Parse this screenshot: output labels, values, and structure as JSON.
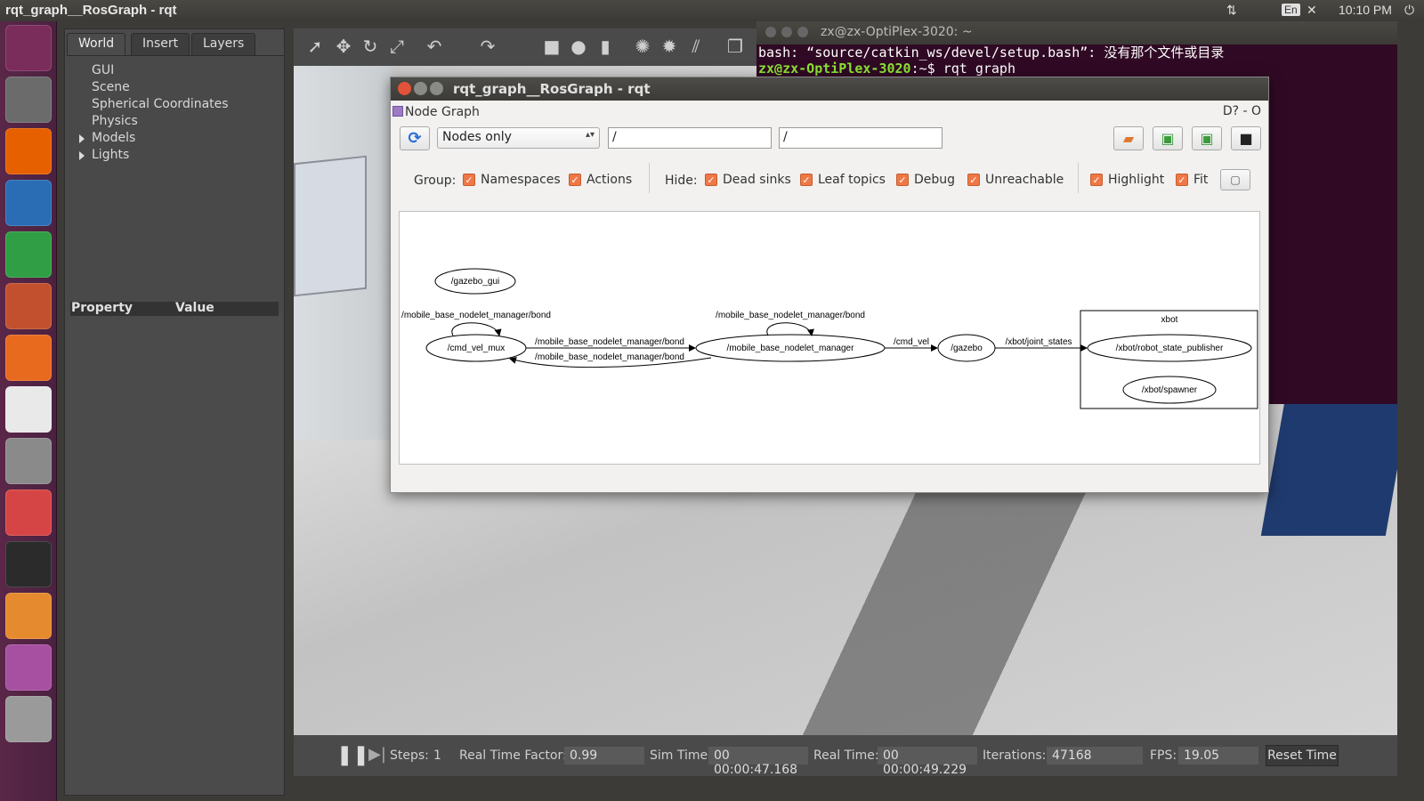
{
  "topbar": {
    "title": "rqt_graph__RosGraph - rqt",
    "lang": "En",
    "time": "10:10 PM"
  },
  "launcher": {
    "items": [
      {
        "name": "ubuntu-dash-icon",
        "color": "#7a2c5a"
      },
      {
        "name": "files-icon",
        "color": "#6b6b6b"
      },
      {
        "name": "firefox-icon",
        "color": "#e66000"
      },
      {
        "name": "writer-icon",
        "color": "#2a6db5"
      },
      {
        "name": "calc-icon",
        "color": "#2f9e44"
      },
      {
        "name": "impress-icon",
        "color": "#c2502e"
      },
      {
        "name": "software-center-icon",
        "color": "#e86a1f"
      },
      {
        "name": "amazon-icon",
        "color": "#e9e9e9"
      },
      {
        "name": "system-settings-icon",
        "color": "#8a8a8a"
      },
      {
        "name": "document-viewer-icon",
        "color": "#d64545"
      },
      {
        "name": "terminal-icon",
        "color": "#2b2b2b"
      },
      {
        "name": "gazebo-icon",
        "color": "#e58a2e"
      },
      {
        "name": "rqt-icon",
        "color": "#a74fa0"
      },
      {
        "name": "trash-icon",
        "color": "#9a9a9a"
      }
    ]
  },
  "gazebo": {
    "tabs": [
      "World",
      "Insert",
      "Layers"
    ],
    "tree": [
      "GUI",
      "Scene",
      "Spherical Coordinates",
      "Physics",
      "Models",
      "Lights"
    ],
    "property_header": {
      "property": "Property",
      "value": "Value"
    },
    "status": {
      "steps_label": "Steps:",
      "steps_value": "1",
      "rtf_label": "Real Time Factor:",
      "rtf_value": "0.99",
      "sim_label": "Sim Time:",
      "sim_value": "00 00:00:47.168",
      "real_label": "Real Time:",
      "real_value": "00 00:00:49.229",
      "iter_label": "Iterations:",
      "iter_value": "47168",
      "fps_label": "FPS:",
      "fps_value": "19.05",
      "reset_label": "Reset Time"
    }
  },
  "terminal": {
    "title": "zx@zx-OptiPlex-3020: ~",
    "line1": "bash: “source/catkin_ws/devel/setup.bash”: 没有那个文件或目录",
    "prompt": "zx@zx-OptiPlex-3020",
    "path": ":~$ rqt graph"
  },
  "rqt": {
    "title": "rqt_graph__RosGraph - rqt",
    "plugin": "Node Graph",
    "mode": "Nodes only",
    "filter1": "/",
    "filter2": "/",
    "group_label": "Group:",
    "hide_label": "Hide:",
    "checks": {
      "namespaces": "Namespaces",
      "actions": "Actions",
      "dead_sinks": "Dead sinks",
      "leaf_topics": "Leaf topics",
      "debug": "Debug",
      "unreachable": "Unreachable",
      "highlight": "Highlight",
      "fit": "Fit"
    },
    "corner": "D? - O"
  },
  "graph": {
    "nodes": {
      "gazebo_gui": "/gazebo_gui",
      "cmd_vel_mux": "/cmd_vel_mux",
      "manager": "/mobile_base_nodelet_manager",
      "gazebo": "/gazebo",
      "robot_state_publisher": "/xbot/robot_state_publisher",
      "spawner": "/xbot/spawner"
    },
    "cluster": "xbot",
    "edges": {
      "bond_loop_mux": "/mobile_base_nodelet_manager/bond",
      "bond_loop_mgr": "/mobile_base_nodelet_manager/bond",
      "bond_to_mgr": "/mobile_base_nodelet_manager/bond",
      "bond_to_mux": "/mobile_base_nodelet_manager/bond",
      "cmd_vel": "/cmd_vel",
      "joint_states": "/xbot/joint_states"
    }
  }
}
